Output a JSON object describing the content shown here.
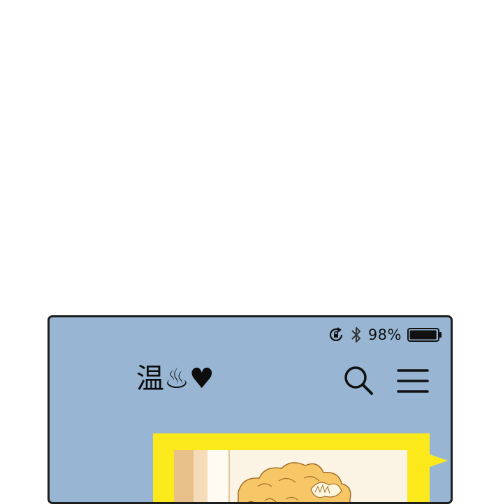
{
  "status_bar": {
    "battery_percent": "98%",
    "battery_level": 0.98,
    "icons": [
      "rotation-lock-icon",
      "bluetooth-icon",
      "battery-icon"
    ]
  },
  "header": {
    "app_logo_text": "温♨♥",
    "icons": [
      "search-icon",
      "menu-icon"
    ]
  },
  "colors": {
    "screen_background": "#98b6d4",
    "thumbnail_frame": "#fbe91c",
    "phone_border": "#1e1e1e",
    "text": "#111111"
  }
}
